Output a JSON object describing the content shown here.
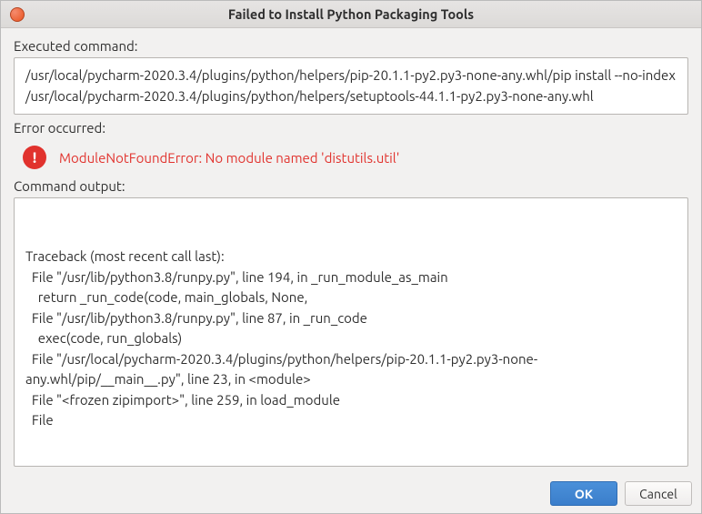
{
  "window": {
    "title": "Failed to Install Python Packaging Tools"
  },
  "labels": {
    "executed": "Executed command:",
    "error_occurred": "Error occurred:",
    "command_output": "Command output:"
  },
  "executed_command": "/usr/local/pycharm-2020.3.4/plugins/python/helpers/pip-20.1.1-py2.py3-none-any.whl/pip install --no-index /usr/local/pycharm-2020.3.4/plugins/python/helpers/setuptools-44.1.1-py2.py3-none-any.whl",
  "error": {
    "message": "ModuleNotFoundError: No module named 'distutils.util'"
  },
  "command_output": "\nTraceback (most recent call last):\n  File \"/usr/lib/python3.8/runpy.py\", line 194, in _run_module_as_main\n    return _run_code(code, main_globals, None,\n  File \"/usr/lib/python3.8/runpy.py\", line 87, in _run_code\n    exec(code, run_globals)\n  File \"/usr/local/pycharm-2020.3.4/plugins/python/helpers/pip-20.1.1-py2.py3-none-any.whl/pip/__main__.py\", line 23, in <module>\n  File \"<frozen zipimport>\", line 259, in load_module\n  File",
  "buttons": {
    "ok": "OK",
    "cancel": "Cancel"
  },
  "icons": {
    "error_glyph": "!"
  }
}
